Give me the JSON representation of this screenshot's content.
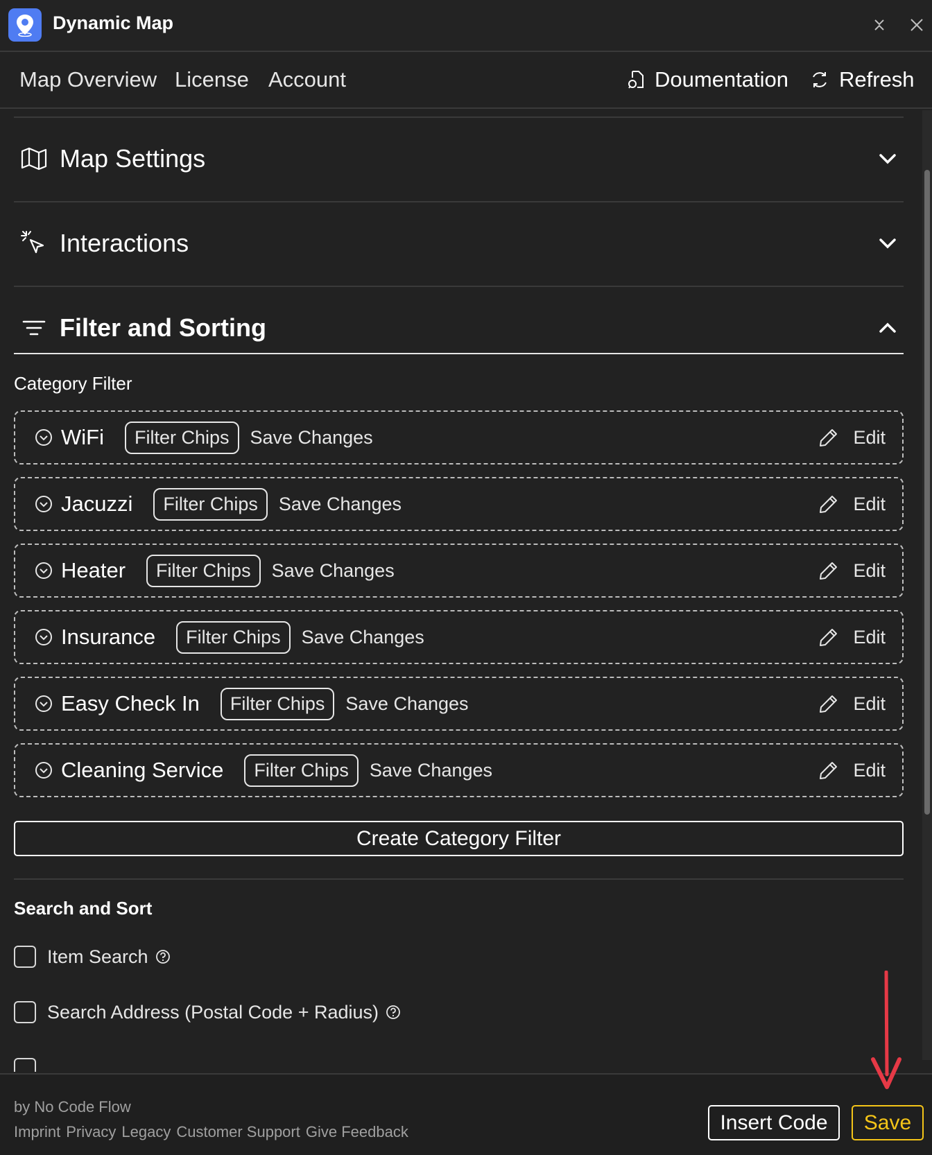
{
  "app": {
    "title": "Dynamic Map",
    "icon": "map-pin-icon",
    "accent": "#4f7cf2"
  },
  "nav": {
    "items": [
      {
        "label": "Map Overview"
      },
      {
        "label": "License"
      },
      {
        "label": "Account"
      }
    ],
    "documentation_label": "Doumentation",
    "refresh_label": "Refresh"
  },
  "sections": {
    "map_settings": {
      "label": "Map Settings",
      "icon": "map-icon",
      "expanded": false
    },
    "interactions": {
      "label": "Interactions",
      "icon": "pointer-click-icon",
      "expanded": false
    },
    "filter_sorting": {
      "label": "Filter and Sorting",
      "icon": "filter-lines-icon",
      "expanded": true
    }
  },
  "category_filter": {
    "heading": "Category Filter",
    "items": [
      {
        "name": "WiFi",
        "chip": "Filter Chips",
        "action": "Save Changes",
        "edit": "Edit"
      },
      {
        "name": "Jacuzzi",
        "chip": "Filter Chips",
        "action": "Save Changes",
        "edit": "Edit"
      },
      {
        "name": "Heater",
        "chip": "Filter Chips",
        "action": "Save Changes",
        "edit": "Edit"
      },
      {
        "name": "Insurance",
        "chip": "Filter Chips",
        "action": "Save Changes",
        "edit": "Edit"
      },
      {
        "name": "Easy Check In",
        "chip": "Filter Chips",
        "action": "Save Changes",
        "edit": "Edit"
      },
      {
        "name": "Cleaning Service",
        "chip": "Filter Chips",
        "action": "Save Changes",
        "edit": "Edit"
      }
    ],
    "create_label": "Create Category Filter"
  },
  "search_sort": {
    "heading": "Search and Sort",
    "options": [
      {
        "label": "Item Search",
        "checked": false
      },
      {
        "label": "Search Address (Postal Code + Radius)",
        "checked": false
      }
    ]
  },
  "footer": {
    "byline": "by No Code Flow",
    "links": [
      "Imprint",
      "Privacy",
      "Legacy",
      "Customer Support",
      "Give Feedback"
    ],
    "insert_code_label": "Insert Code",
    "save_label": "Save",
    "save_color": "#f5c518"
  },
  "annotation": {
    "arrow_color": "#e63946"
  }
}
